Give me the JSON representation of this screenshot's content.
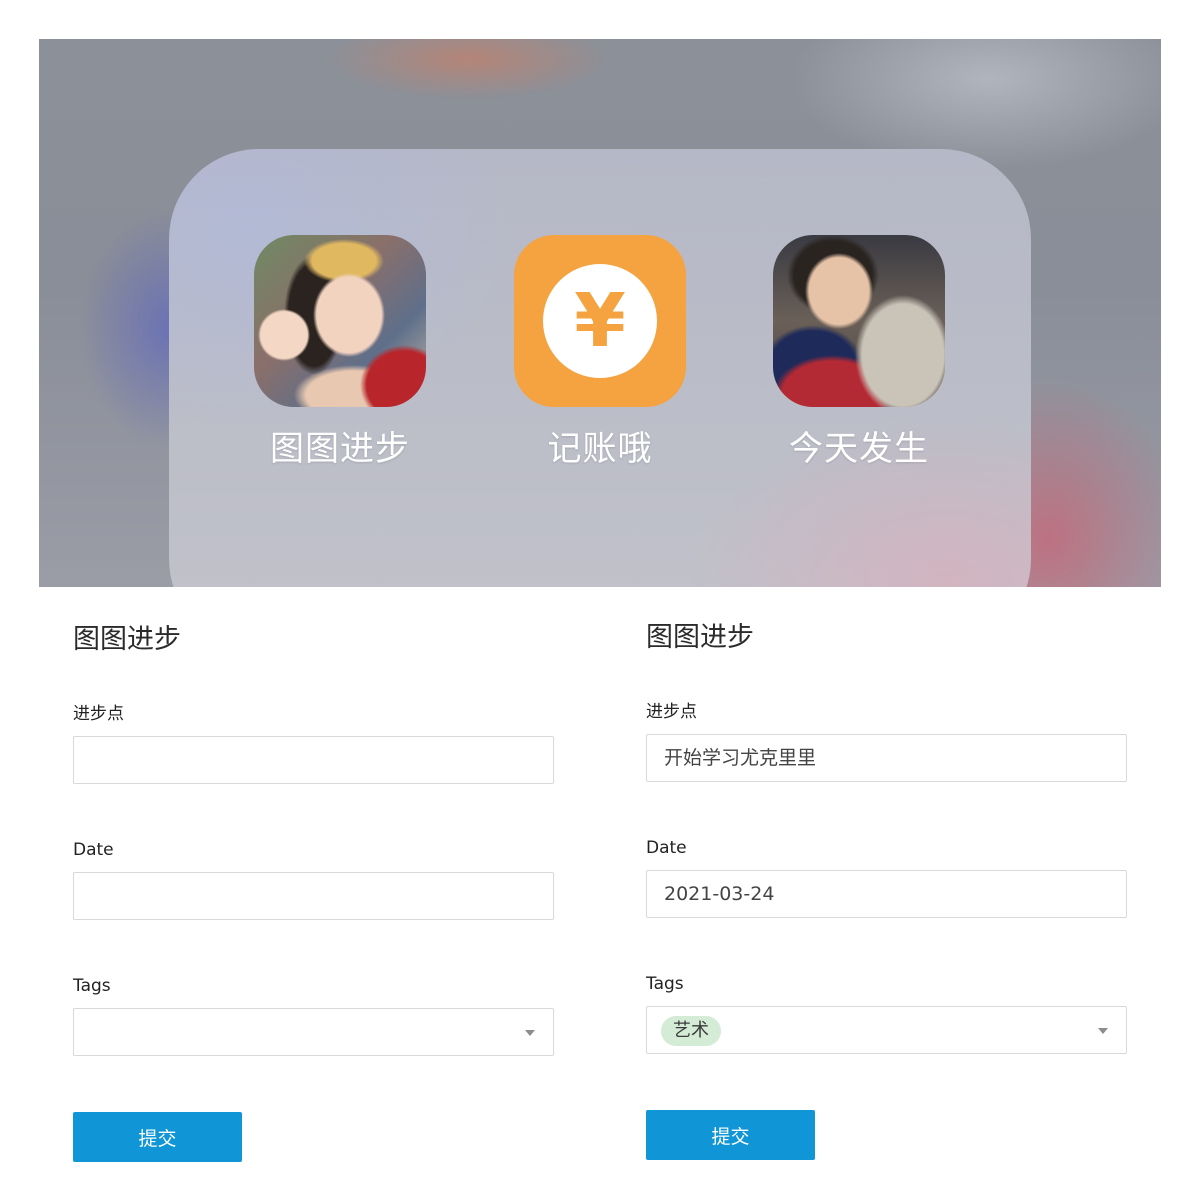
{
  "home_screen": {
    "apps": [
      {
        "label": "图图进步",
        "icon": "family-photo-icon"
      },
      {
        "label": "记账哦",
        "icon": "yuan-icon",
        "glyph": "¥",
        "color": "#f4a340"
      },
      {
        "label": "今天发生",
        "icon": "selfie-with-cat-icon"
      }
    ]
  },
  "form_empty": {
    "title": "图图进步",
    "fields": {
      "progress_label": "进步点",
      "progress_value": "",
      "date_label": "Date",
      "date_value": "",
      "tags_label": "Tags"
    },
    "submit_label": "提交"
  },
  "form_filled": {
    "title": "图图进步",
    "fields": {
      "progress_label": "进步点",
      "progress_value": "开始学习尤克里里",
      "date_label": "Date",
      "date_value": "2021-03-24",
      "tags_label": "Tags",
      "tags": [
        "艺术"
      ]
    },
    "submit_label": "提交"
  },
  "colors": {
    "accent": "#1095d6",
    "tag_bg": "#d4ecd6",
    "app_orange": "#f4a340"
  }
}
